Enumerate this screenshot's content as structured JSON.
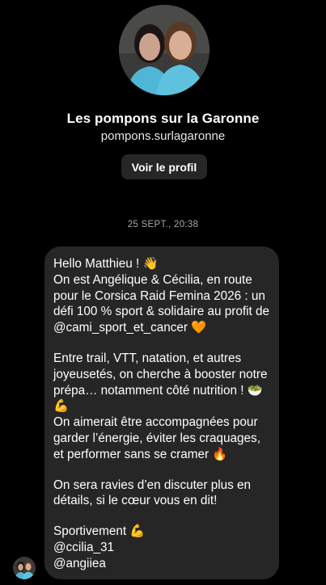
{
  "profile": {
    "name": "Les pompons sur la Garonne",
    "username": "pompons.surlagaronne",
    "view_profile_label": "Voir le profil"
  },
  "conversation": {
    "timestamp": "25 SEPT., 20:38",
    "message": {
      "paragraphs": [
        "Hello Matthieu ! 👋\nOn est Angélique & Cécilia, en route pour le Corsica Raid Femina 2026 : un défi 100 % sport & solidaire au profit de @cami_sport_et_cancer 🧡",
        "Entre trail, VTT, natation, et autres joyeusetés, on cherche à booster notre prépa… notamment côté nutrition ! 🥗💪\nOn aimerait être accompagnées pour garder l’énergie, éviter les craquages, et performer sans se cramer 🔥",
        "On sera ravies d’en discuter plus en détails, si le cœur vous en dit!",
        "Sportivement 💪\n@ccilia_31\n@angiiea"
      ]
    }
  }
}
